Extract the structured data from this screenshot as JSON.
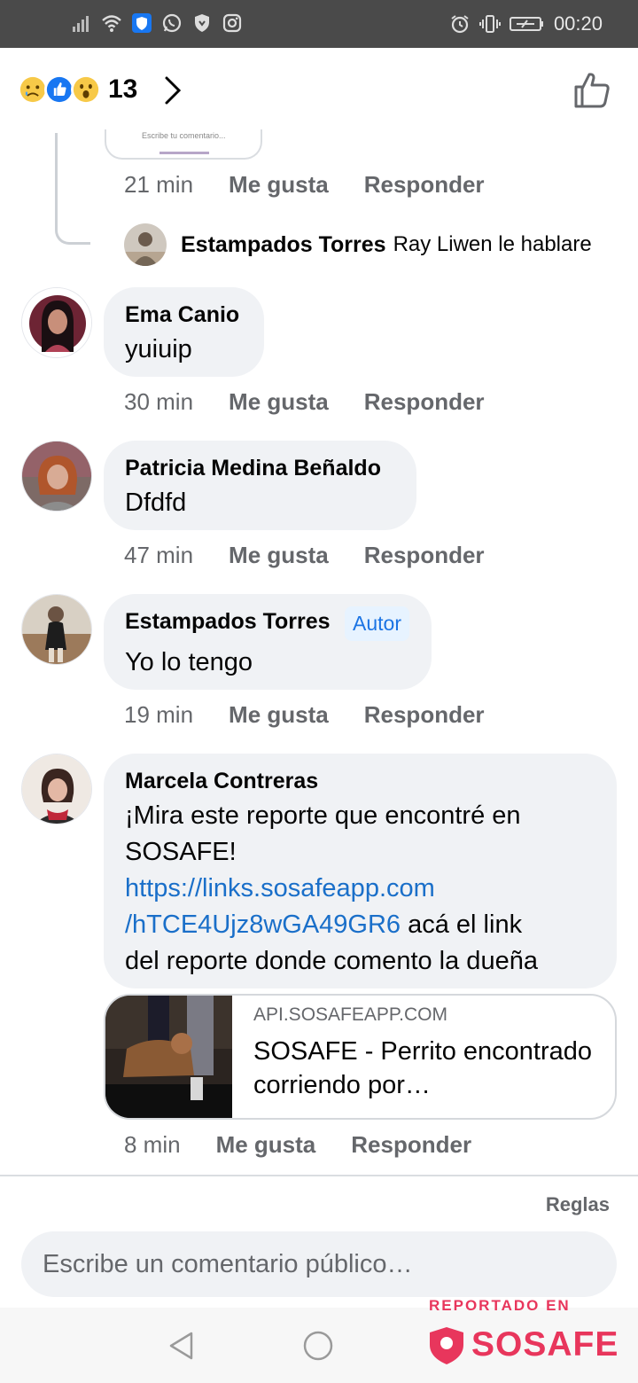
{
  "status_bar": {
    "time": "00:20",
    "left_icons": [
      "signal-icon",
      "wifi-icon",
      "shield-app-icon",
      "whatsapp-icon",
      "vpn-shield-icon",
      "instagram-icon"
    ],
    "right_icons": [
      "alarm-icon",
      "vibrate-icon",
      "battery-icon"
    ]
  },
  "header": {
    "reactions": [
      "sad-reaction",
      "like-reaction",
      "wow-reaction"
    ],
    "reaction_count": "13"
  },
  "thread_reply": {
    "time": "21 min",
    "like": "Me gusta",
    "reply": "Responder",
    "nested_author": "Estampados Torres",
    "nested_text": "Ray Liwen le hablare",
    "mini_input_text": "Escribe tu comentario..."
  },
  "comments": [
    {
      "author": "Ema Canio",
      "text": "yuiuip",
      "time": "30 min",
      "like": "Me gusta",
      "reply": "Responder"
    },
    {
      "author": "Patricia Medina Beñaldo",
      "text": "Dfdfd",
      "time": "47 min",
      "like": "Me gusta",
      "reply": "Responder"
    },
    {
      "author": "Estampados Torres",
      "badge": "Autor",
      "text": "Yo lo tengo",
      "time": "19 min",
      "like": "Me gusta",
      "reply": "Responder"
    },
    {
      "author": "Marcela Contreras",
      "text_line1": "¡Mira este reporte que encontré en",
      "text_line2": "SOSAFE!",
      "link_line1": "https://links.sosafeapp.com",
      "link_line2": "/hTCE4Ujz8wGA49GR6",
      "text_after_link": " acá el link",
      "text_line5": "del reporte donde comento la dueña",
      "preview_domain": "API.SOSAFEAPP.COM",
      "preview_title": "SOSAFE - Perrito encontrado corriendo por…",
      "time": "8 min",
      "like": "Me gusta",
      "reply": "Responder"
    }
  ],
  "footer": {
    "rules": "Reglas",
    "composer_placeholder": "Escribe un comentario público…"
  },
  "watermark": {
    "reported_in": "REPORTADO EN",
    "brand": "SOSAFE"
  },
  "colors": {
    "status_bar": "#4a4a4a",
    "bubble": "#f0f2f5",
    "link": "#1a6fc9",
    "meta": "#65676b",
    "sosafe": "#e8365c"
  }
}
